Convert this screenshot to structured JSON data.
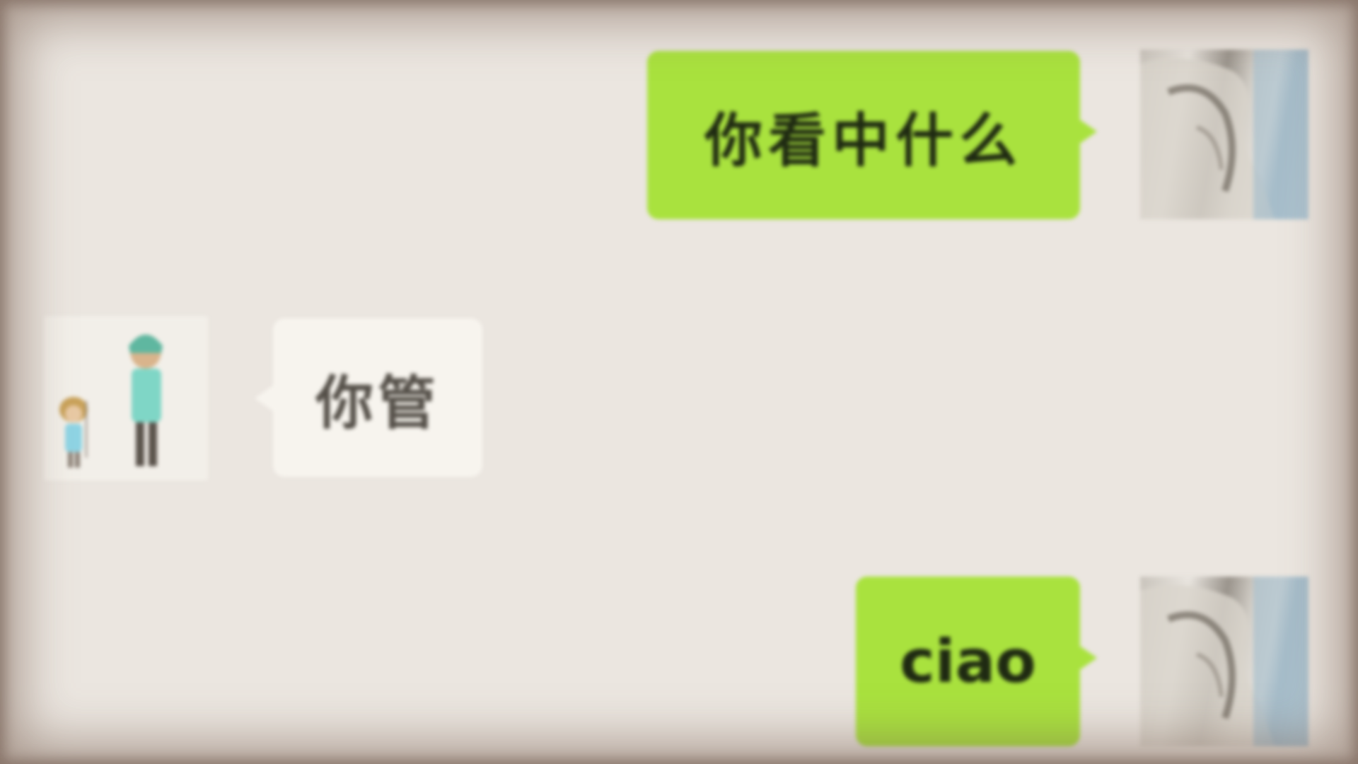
{
  "chat": {
    "messages": [
      {
        "sender": "self",
        "text": "你看中什么",
        "bubble_color": "#a9e23e"
      },
      {
        "sender": "other",
        "text": "你管",
        "bubble_color": "#f7f4ee"
      },
      {
        "sender": "self",
        "text": "ciao",
        "bubble_color": "#a9e23e"
      }
    ],
    "avatars": {
      "self": "photo-avatar",
      "other": "cartoon-couple-avatar"
    }
  },
  "colors": {
    "background": "#ebe6e0",
    "sent_bubble": "#a9e23e",
    "received_bubble": "#f7f4ee"
  }
}
